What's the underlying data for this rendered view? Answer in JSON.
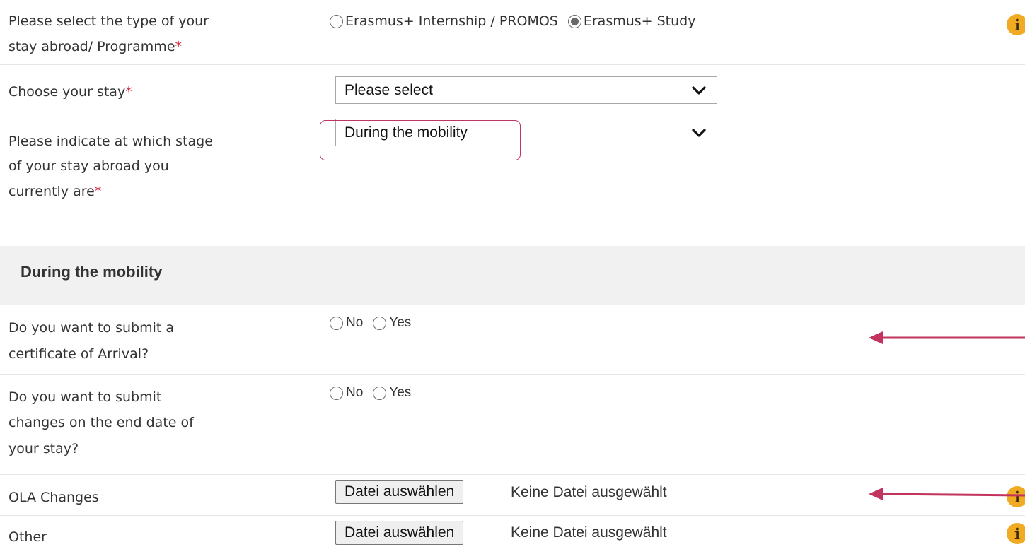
{
  "programme": {
    "label": "Please select the type of your",
    "label_line2": "stay abroad/ Programme",
    "required_mark": "*",
    "options": [
      {
        "label": "Erasmus+ Internship / PROMOS",
        "checked": false
      },
      {
        "label": "Erasmus+ Study",
        "checked": true
      }
    ]
  },
  "stay": {
    "label": "Choose your stay",
    "required_mark": "*",
    "selected": "Please select"
  },
  "stage": {
    "label_line1": "Please indicate at which stage",
    "label_line2": "of your stay abroad you",
    "label_line3": "currently are",
    "required_mark": "*",
    "selected": "During the mobility"
  },
  "section": {
    "title": "During the mobility"
  },
  "arrival": {
    "label_line1": "Do you want to submit a",
    "label_line2": "certificate of Arrival?",
    "options": [
      {
        "label": "No",
        "checked": false
      },
      {
        "label": "Yes",
        "checked": false
      }
    ]
  },
  "end_date": {
    "label_line1": "Do you want to submit",
    "label_line2": "changes on the end date of",
    "label_line3": "your stay?",
    "options": [
      {
        "label": "No",
        "checked": false
      },
      {
        "label": "Yes",
        "checked": false
      }
    ]
  },
  "ola_changes": {
    "label": "OLA Changes",
    "button_label": "Datei auswählen",
    "status": "Keine Datei ausgewählt"
  },
  "other": {
    "label": "Other",
    "button_label": "Datei auswählen",
    "status": "Keine Datei ausgewählt"
  },
  "info_icon_glyph": "i",
  "colors": {
    "required": "#d9223a",
    "info_icon": "#f0ab23",
    "annotation": "#c2335e",
    "section_bg": "#f1f1f1"
  }
}
